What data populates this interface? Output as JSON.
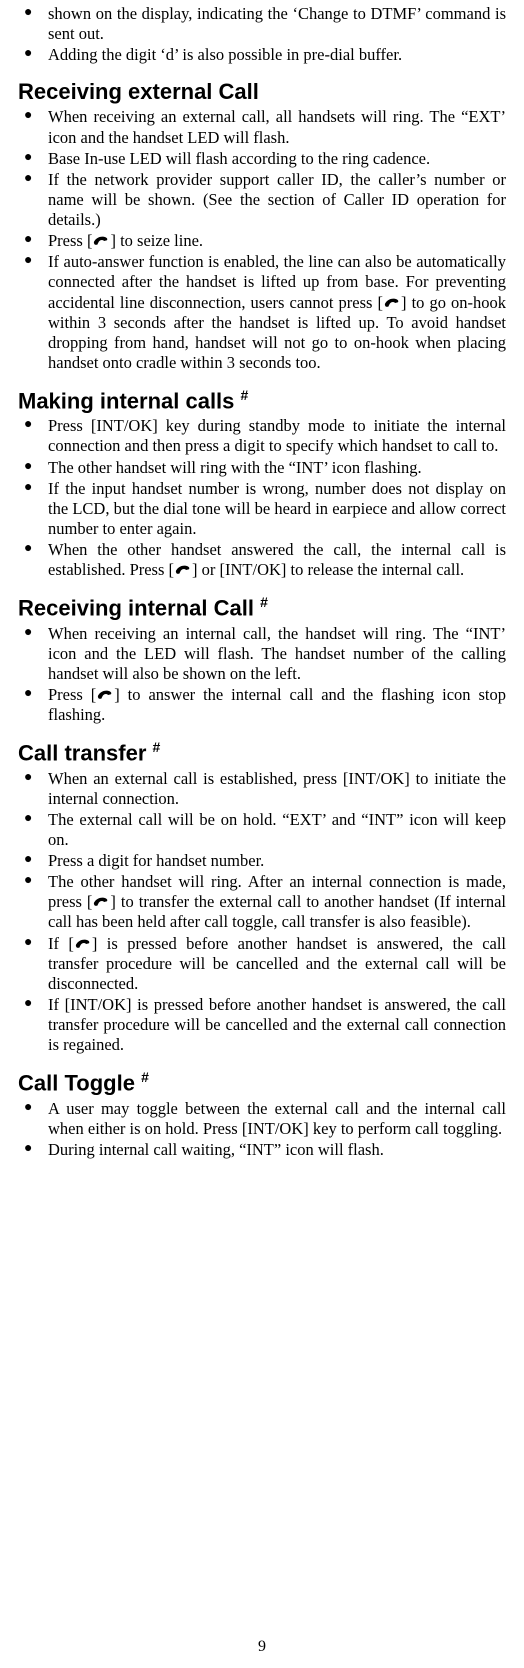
{
  "intro_items": [
    "shown on the display, indicating the ‘Change to DTMF’ command is sent out.",
    "Adding the digit ‘d’ is also possible in pre-dial buffer."
  ],
  "sections": {
    "recv_ext": {
      "heading": "Receiving external Call",
      "items": [
        {
          "t": [
            "When receiving an external call, all handsets will ring. The “EXT’ icon and the handset LED will flash."
          ]
        },
        {
          "t": [
            "Base In-use LED will flash according to the ring cadence."
          ]
        },
        {
          "t": [
            "If the network provider support caller ID, the caller’s number or name will be shown. (See the section of Caller ID operation for details.)"
          ]
        },
        {
          "t": [
            "Press [",
            "PHONE",
            "] to seize line."
          ]
        },
        {
          "t": [
            "If auto-answer function is enabled, the line can also be automatically connected after the handset is lifted up from base. For preventing accidental line disconnection, users cannot press [",
            "PHONE",
            "] to go on-hook within 3 seconds after the handset is lifted up. To avoid handset dropping from hand, handset will not go to on-hook when placing handset onto cradle within 3 seconds too."
          ]
        }
      ]
    },
    "make_int": {
      "heading": "Making internal calls",
      "sup": "#",
      "items": [
        {
          "t": [
            "Press [INT/OK] key during standby mode to initiate the internal connection and then press a digit to specify which handset to call to."
          ]
        },
        {
          "t": [
            "The other handset will ring with the “INT’ icon flashing."
          ]
        },
        {
          "t": [
            "If the input handset number is wrong, number does not display on the LCD, but the dial tone will be heard in earpiece and allow correct number to enter again."
          ]
        },
        {
          "t": [
            "When the other handset answered the call, the internal call is established. Press [",
            "PHONE",
            "] or [INT/OK] to release the internal call."
          ]
        }
      ]
    },
    "recv_int": {
      "heading": "Receiving internal Call",
      "sup": "#",
      "items": [
        {
          "t": [
            "When receiving an internal call, the handset will ring. The “INT’ icon and the LED will flash. The handset number of the calling handset will also be shown on the left."
          ]
        },
        {
          "t": [
            "Press [",
            "PHONE",
            "] to answer the internal call and the flashing icon stop flashing."
          ]
        }
      ]
    },
    "transfer": {
      "heading": "Call transfer",
      "sup": "#",
      "items": [
        {
          "t": [
            "When an external call is established, press [INT/OK] to initiate the internal connection."
          ]
        },
        {
          "t": [
            "The external call will be on hold. “EXT’ and “INT” icon will keep on."
          ]
        },
        {
          "t": [
            "Press a digit for handset number."
          ]
        },
        {
          "t": [
            "The other handset will ring. After an internal connection is made, press [",
            "PHONE",
            "] to transfer the external call to another handset (If internal call has been held after call toggle, call transfer is also feasible)."
          ]
        },
        {
          "t": [
            "If [",
            "PHONE",
            "] is pressed before another handset is answered, the call transfer procedure will be cancelled and the external call will be disconnected."
          ]
        },
        {
          "t": [
            "If [INT/OK] is pressed before another handset is answered, the call transfer procedure will be cancelled and the external call connection is regained."
          ]
        }
      ]
    },
    "toggle": {
      "heading": "Call Toggle",
      "sup": "#",
      "items": [
        {
          "t": [
            "A user may toggle between the external call and the internal call when either is on hold. Press [INT/OK] key to perform call toggling."
          ]
        },
        {
          "t": [
            "During internal call waiting, “INT” icon will flash."
          ]
        }
      ]
    }
  },
  "page_number": "9"
}
